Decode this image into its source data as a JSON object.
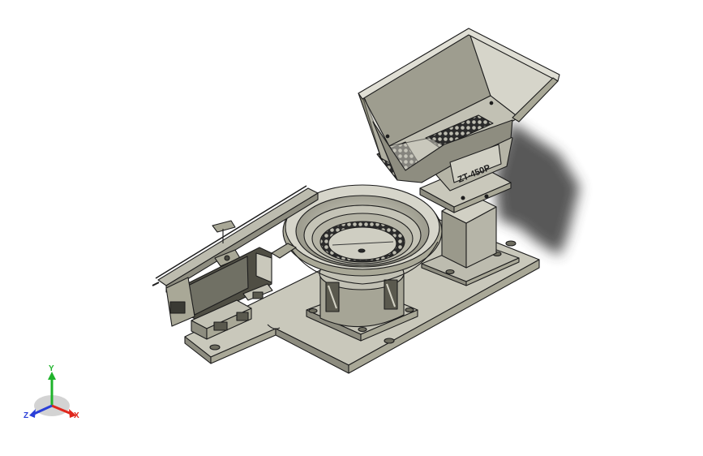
{
  "model": {
    "hopper_label": "ZT-450P"
  },
  "triad": {
    "x_label": "X",
    "y_label": "Y",
    "z_label": "Z"
  },
  "colors": {
    "background": "#ffffff",
    "metal_light": "#c9c8bb",
    "metal_mid": "#a9a897",
    "metal_dark": "#6e6d60",
    "edge": "#1d1d1d",
    "shadow": "#2e2e2e",
    "axis_x": "#e0271d",
    "axis_y": "#1fb32b",
    "axis_z": "#2a3fd8"
  }
}
